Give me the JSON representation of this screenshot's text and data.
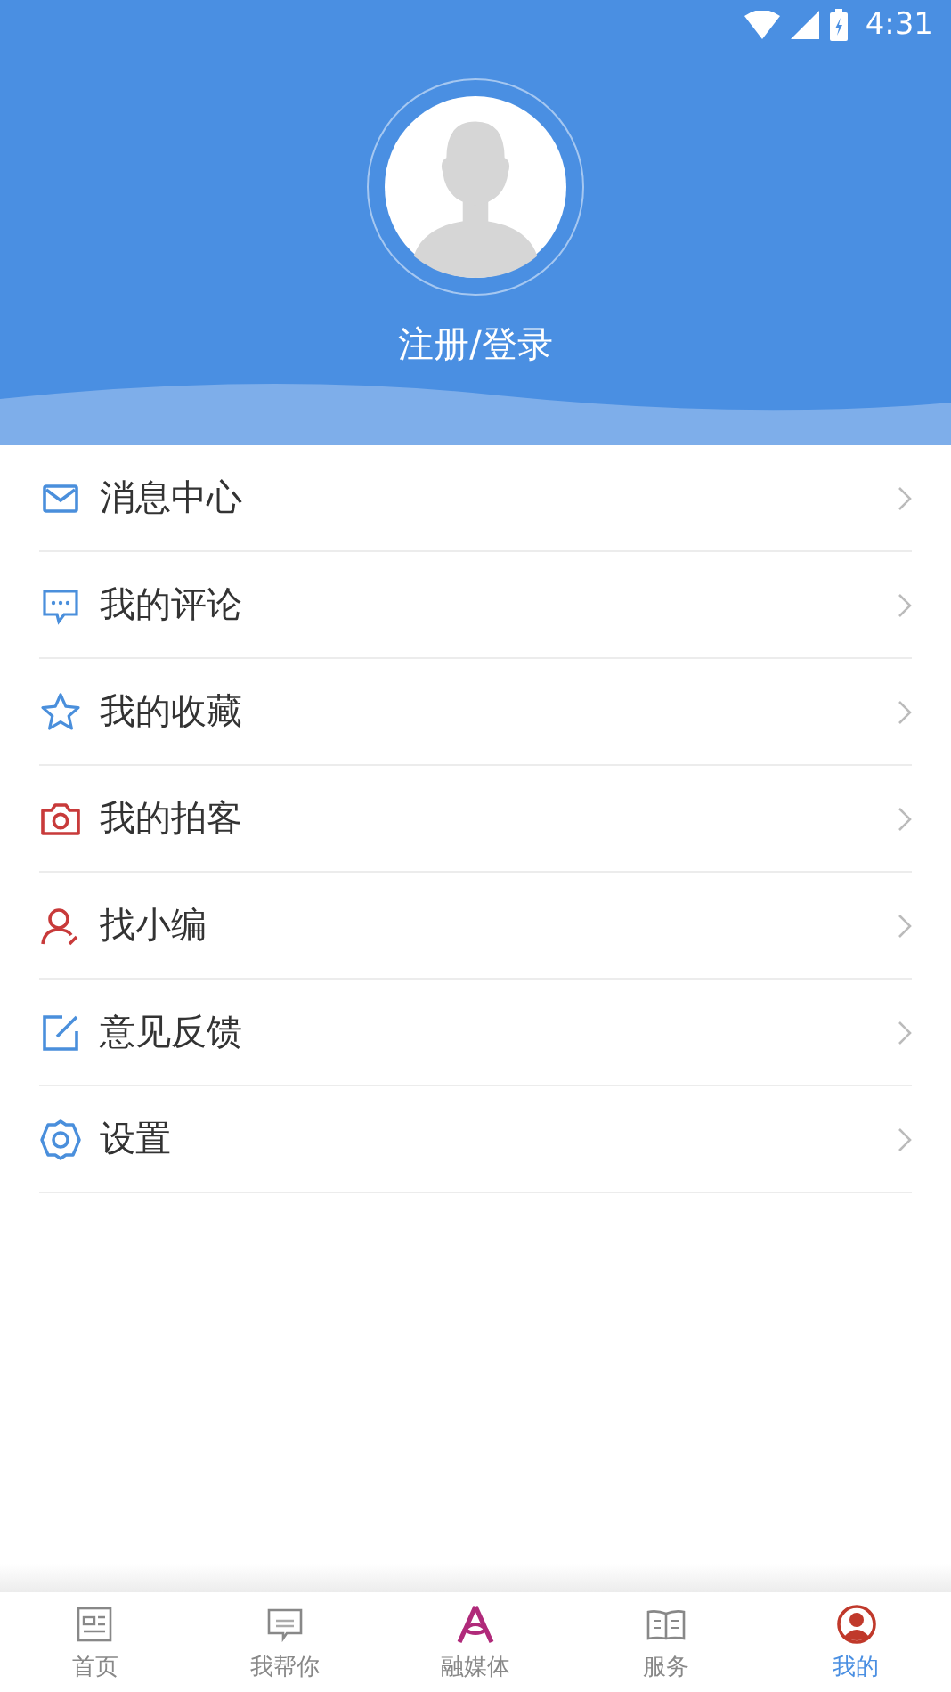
{
  "status_bar": {
    "time": "4:31"
  },
  "profile": {
    "login_label": "注册/登录"
  },
  "menu": [
    {
      "kind": "mail",
      "label": "消息中心",
      "color": "#4a8fdc"
    },
    {
      "kind": "comment",
      "label": "我的评论",
      "color": "#4a8fdc"
    },
    {
      "kind": "star",
      "label": "我的收藏",
      "color": "#4a8fdc"
    },
    {
      "kind": "camera",
      "label": "我的拍客",
      "color": "#c83a3a"
    },
    {
      "kind": "person",
      "label": "找小编",
      "color": "#c83a3a"
    },
    {
      "kind": "edit",
      "label": "意见反馈",
      "color": "#4a8fdc"
    },
    {
      "kind": "gear",
      "label": "设置",
      "color": "#4a8fdc"
    }
  ],
  "tabs": [
    {
      "kind": "news",
      "label": "首页",
      "selected": false
    },
    {
      "kind": "chat",
      "label": "我帮你",
      "selected": false
    },
    {
      "kind": "logo",
      "label": "融媒体",
      "selected": false
    },
    {
      "kind": "book",
      "label": "服务",
      "selected": false
    },
    {
      "kind": "profile",
      "label": "我的",
      "selected": true
    }
  ]
}
